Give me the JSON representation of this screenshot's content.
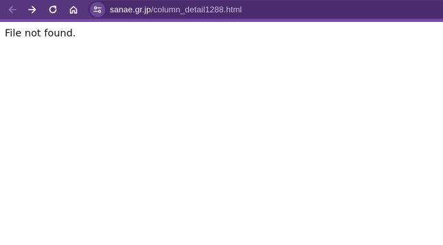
{
  "browser": {
    "url_domain": "sanae.gr.jp",
    "url_path": "/column_detail1288.html",
    "icons": {
      "back": "arrow-left-icon",
      "forward": "arrow-right-icon",
      "reload": "reload-icon",
      "home": "home-icon",
      "site_info": "tune-icon"
    },
    "colors": {
      "toolbar": "#58367e",
      "accent": "#7a4cb0",
      "omnibox": "#4a2b6e"
    }
  },
  "page": {
    "message": "File not found."
  }
}
